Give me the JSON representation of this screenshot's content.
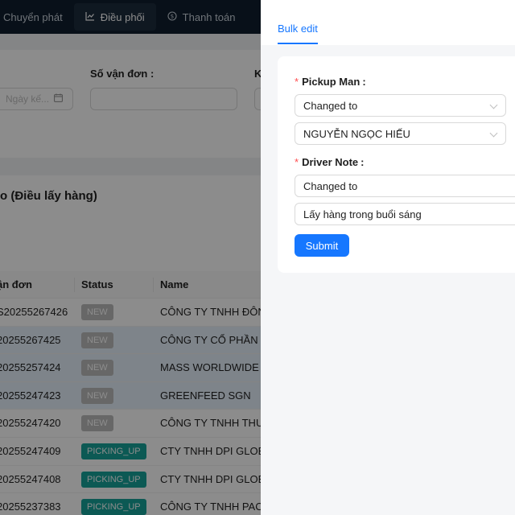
{
  "nav": {
    "items": [
      {
        "label": "Chuyển phát",
        "icon": "",
        "active": false
      },
      {
        "label": "Điều phối",
        "icon": "chart-icon",
        "active": true
      },
      {
        "label": "Thanh toán",
        "icon": "dollar-circle-icon",
        "active": false
      }
    ]
  },
  "filters": {
    "date_placeholder": "Ngày kế...",
    "tracking_label": "Số vận đơn :",
    "third_label_fragment": "K"
  },
  "list": {
    "title": "o (Điều lấy hàng)",
    "columns": [
      "ận đơn",
      "Status",
      "Name"
    ],
    "rows": [
      {
        "code": "S20255267426",
        "status": "NEW",
        "name": "CÔNG TY TNHH ĐÔN",
        "selected": false
      },
      {
        "code": "20255267425",
        "status": "NEW",
        "name": "CÔNG TY CỔ PHẦN H",
        "selected": true
      },
      {
        "code": "20255257424",
        "status": "NEW",
        "name": "MASS WORLDWIDE LO",
        "selected": true
      },
      {
        "code": "20255247423",
        "status": "NEW",
        "name": "GREENFEED SGN",
        "selected": true
      },
      {
        "code": "20255247420",
        "status": "NEW",
        "name": "CÔNG TY TNHH THƯC",
        "selected": false
      },
      {
        "code": "20255247409",
        "status": "PICKING_UP",
        "name": "CTY TNHH DPI GLOBA",
        "selected": false
      },
      {
        "code": "20255247408",
        "status": "PICKING_UP",
        "name": "CTY TNHH DPI GLOBA",
        "selected": false
      },
      {
        "code": "20255237383",
        "status": "PICKING_UP",
        "name": "CÔNG TY TNHH PACIF",
        "selected": false
      }
    ]
  },
  "drawer": {
    "tab_label": "Bulk edit",
    "pickup": {
      "label": "Pickup Man",
      "mode": "Changed to",
      "value": "NGUYỄN NGỌC HIẾU"
    },
    "driver_note": {
      "label": "Driver Note",
      "mode": "Changed to",
      "value": "Lấy hàng trong buổi sáng"
    },
    "submit_label": "Submit"
  },
  "colors": {
    "primary": "#1677ff",
    "nav_bg": "#0f1e2e",
    "badge_new": "#bcbcbc",
    "badge_picking": "#16a39a",
    "required": "#ff4d4f"
  }
}
